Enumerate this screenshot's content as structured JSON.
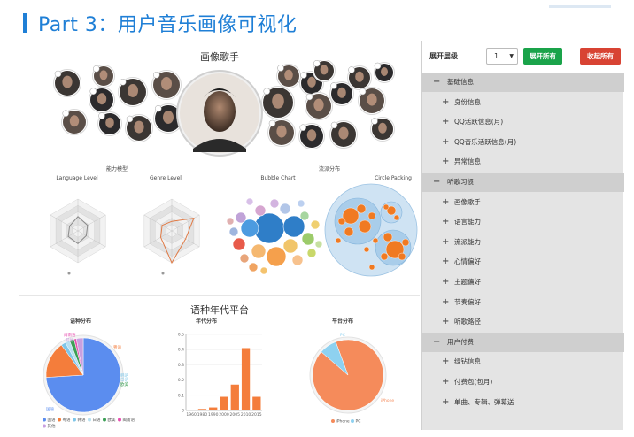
{
  "page_title": "Part 3：用户音乐画像可视化",
  "artist_section": {
    "title": "画像歌手",
    "avatar_count": 22
  },
  "ability_section": {
    "title": "能力模型",
    "language_title": "Language Level",
    "genre_title": "Genre Level"
  },
  "genre_section": {
    "title": "流派分布",
    "bubble_title": "Bubble Chart",
    "circle_title": "Circle Packing"
  },
  "platform_section": {
    "title": "语种年代平台",
    "lang_title": "语种分布",
    "year_title": "年代分布",
    "platform_title": "平台分布"
  },
  "toolbar": {
    "expand_level_label": "展开层级",
    "level_value": "1",
    "expand_all": "展开所有",
    "collapse_all": "收起所有"
  },
  "tree": [
    {
      "type": "group",
      "label": "基础信息"
    },
    {
      "type": "child",
      "label": "身份信息"
    },
    {
      "type": "child",
      "label": "QQ活跃信息(月)"
    },
    {
      "type": "child",
      "label": "QQ音乐活跃信息(月)"
    },
    {
      "type": "child",
      "label": "异常信息"
    },
    {
      "type": "group",
      "label": "听歌习惯"
    },
    {
      "type": "child",
      "label": "画像歌手"
    },
    {
      "type": "child",
      "label": "语言能力"
    },
    {
      "type": "child",
      "label": "流派能力"
    },
    {
      "type": "child",
      "label": "心情偏好"
    },
    {
      "type": "child",
      "label": "主题偏好"
    },
    {
      "type": "child",
      "label": "节奏偏好"
    },
    {
      "type": "child",
      "label": "听歌路径"
    },
    {
      "type": "group",
      "label": "用户付费"
    },
    {
      "type": "child",
      "label": "绿钻信息"
    },
    {
      "type": "child",
      "label": "付费包(包月)"
    },
    {
      "type": "child",
      "label": "单曲、专辑、弹幕送"
    }
  ],
  "chart_data": [
    {
      "type": "pie",
      "title": "语种分布",
      "slices": [
        {
          "label": "国语",
          "value": 74,
          "color": "#5b8def"
        },
        {
          "label": "粤语",
          "value": 16,
          "color": "#f47d3b"
        },
        {
          "label": "韩语",
          "value": 2,
          "color": "#7fc6e8"
        },
        {
          "label": "日语",
          "value": 2,
          "color": "#b8e0f0"
        },
        {
          "label": "欧美",
          "value": 2,
          "color": "#3c9f56"
        },
        {
          "label": "闽南语",
          "value": 1,
          "color": "#e84fb0"
        },
        {
          "label": "其他",
          "value": 3,
          "color": "#c9a0e0"
        }
      ]
    },
    {
      "type": "bar",
      "title": "年代分布",
      "categories": [
        "1960",
        "1980",
        "1990",
        "2000",
        "2005",
        "2010",
        "2015"
      ],
      "values": [
        0.005,
        0.01,
        0.02,
        0.09,
        0.17,
        0.41,
        0.09
      ],
      "ylim": [
        0,
        0.5
      ],
      "yticks": [
        "0",
        "0.1",
        "0.2",
        "0.3",
        "0.4",
        "0.5"
      ],
      "color": "#f47d3b"
    },
    {
      "type": "pie",
      "title": "平台分布",
      "slices": [
        {
          "label": "iPhone",
          "value": 92,
          "color": "#f58b5b"
        },
        {
          "label": "PC",
          "value": 8,
          "color": "#8ed1f0"
        }
      ]
    }
  ]
}
